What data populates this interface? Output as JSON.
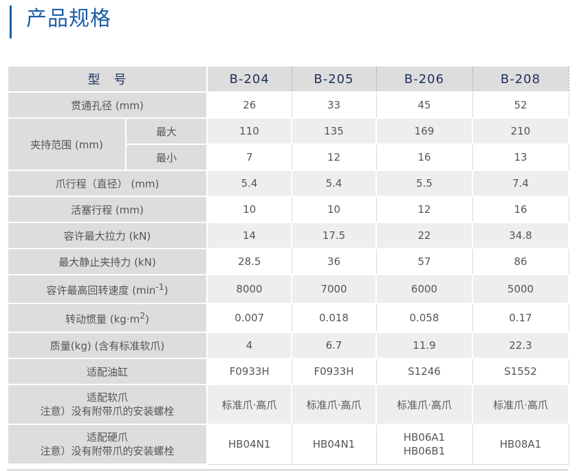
{
  "page": {
    "title": "产品规格"
  },
  "table": {
    "header_label": "型　号",
    "models": [
      "B-204",
      "B-205",
      "B-206",
      "B-208"
    ],
    "rows": {
      "bore": {
        "label": "贯通孔径 (mm)",
        "values": [
          "26",
          "33",
          "45",
          "52"
        ]
      },
      "grip": {
        "label": "夹持范围 (mm)",
        "max": {
          "label": "最大",
          "values": [
            "110",
            "135",
            "169",
            "210"
          ]
        },
        "min": {
          "label": "最小",
          "values": [
            "7",
            "12",
            "16",
            "13"
          ]
        }
      },
      "jaw_stroke": {
        "label": "爪行程（直径） (mm)",
        "values": [
          "5.4",
          "5.4",
          "5.5",
          "7.4"
        ]
      },
      "piston_stroke": {
        "label": "活塞行程 (mm)",
        "values": [
          "10",
          "10",
          "12",
          "16"
        ]
      },
      "max_pull": {
        "label": "容许最大拉力 (kN)",
        "values": [
          "14",
          "17.5",
          "22",
          "34.8"
        ]
      },
      "static_grip": {
        "label": "最大静止夹持力 (kN)",
        "values": [
          "28.5",
          "36",
          "57",
          "86"
        ]
      },
      "max_speed": {
        "label": "容许最高回转速度 (min",
        "sup": "-1",
        "tail": ")",
        "values": [
          "8000",
          "7000",
          "6000",
          "5000"
        ]
      },
      "inertia": {
        "label": "转动惯量 (kg·m",
        "sup": "2",
        "tail": ")",
        "values": [
          "0.007",
          "0.018",
          "0.058",
          "0.17"
        ]
      },
      "mass": {
        "label": "质量(kg) (含有标准软爪)",
        "values": [
          "4",
          "6.7",
          "11.9",
          "22.3"
        ]
      },
      "cylinder": {
        "label": "适配油缸",
        "values": [
          "F0933H",
          "F0933H",
          "S1246",
          "S1552"
        ]
      },
      "soft_jaw": {
        "label_line1": "适配软爪",
        "label_line2": "注意）没有附带爪的安装螺栓",
        "values": [
          "标准爪·高爪",
          "标准爪·高爪",
          "标准爪·高爪",
          "标准爪·高爪"
        ]
      },
      "hard_jaw": {
        "label_line1": "适配硬爪",
        "label_line2": "注意）没有附带爪的安装螺栓",
        "values": [
          "HB04N1",
          "HB04N1",
          "HB06A1",
          "HB08A1"
        ],
        "values_line2": [
          "",
          "",
          "HB06B1",
          ""
        ]
      }
    }
  }
}
